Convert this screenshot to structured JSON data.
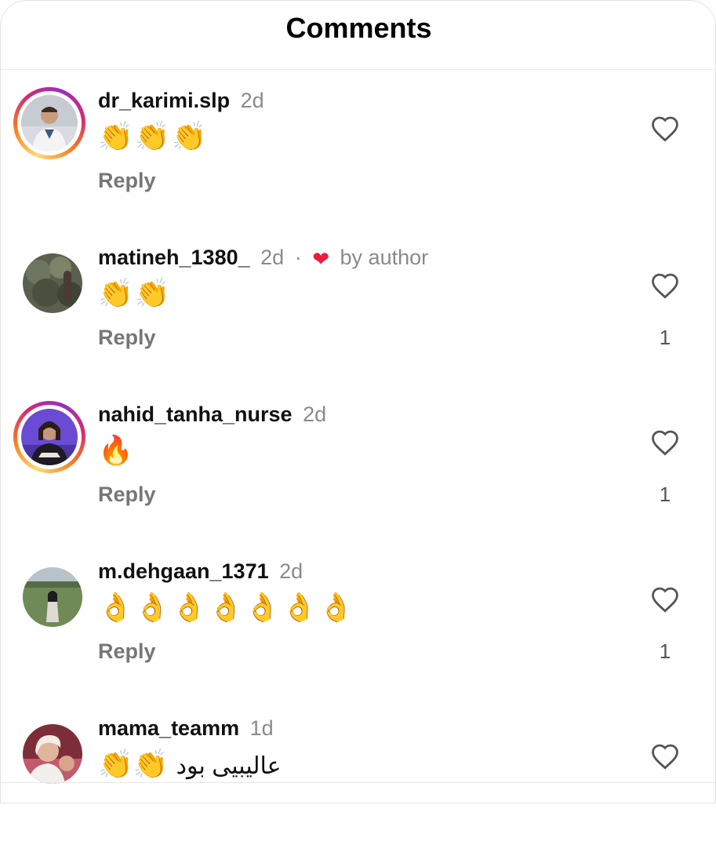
{
  "header": {
    "title": "Comments"
  },
  "colors": {
    "accent_like": "#ed1c3c",
    "muted_text": "#8a8a8a"
  },
  "icons": {
    "like": "heart-outline-icon",
    "author_like": "heart-filled-icon"
  },
  "comments": [
    {
      "username": "dr_karimi.slp",
      "time": "2d",
      "text": "👏👏👏",
      "reply_label": "Reply",
      "likes": "",
      "story_ring": true,
      "author_liked": false
    },
    {
      "username": "matineh_1380_",
      "time": "2d",
      "separator": "·",
      "author_like_heart": "❤",
      "author_like_label": "by author",
      "text": "👏👏",
      "reply_label": "Reply",
      "likes": "1",
      "story_ring": false,
      "author_liked": true
    },
    {
      "username": "nahid_tanha_nurse",
      "time": "2d",
      "text": "🔥",
      "reply_label": "Reply",
      "likes": "1",
      "story_ring": true,
      "author_liked": false
    },
    {
      "username": "m.dehgaan_1371",
      "time": "2d",
      "text": "👌👌👌👌👌👌👌",
      "reply_label": "Reply",
      "likes": "1",
      "story_ring": false,
      "author_liked": false
    },
    {
      "username": "mama_teamm",
      "time": "1d",
      "text": "👏👏",
      "text_rtl": "عالیبیی بود",
      "reply_label": "",
      "likes": "",
      "story_ring": false,
      "author_liked": false
    }
  ]
}
